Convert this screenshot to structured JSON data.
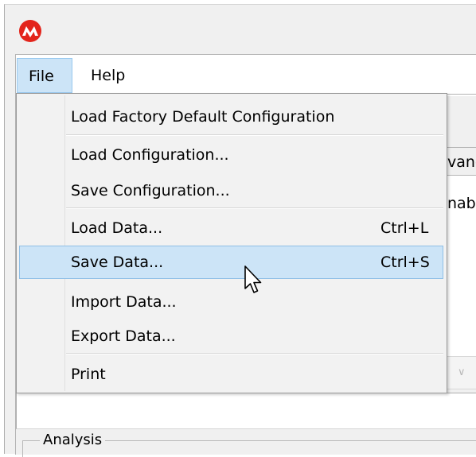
{
  "window": {
    "logo_icon": "microchip-logo-icon",
    "logo_color": "#e3241b"
  },
  "menubar": {
    "file_label": "File",
    "help_label": "Help"
  },
  "file_menu": {
    "items": [
      {
        "label": "Load Factory Default Configuration",
        "shortcut": ""
      },
      {
        "label": "Load Configuration...",
        "shortcut": ""
      },
      {
        "label": "Save Configuration...",
        "shortcut": ""
      },
      {
        "label": "Load Data...",
        "shortcut": "Ctrl+L"
      },
      {
        "label": "Save Data...",
        "shortcut": "Ctrl+S"
      },
      {
        "label": "Import Data...",
        "shortcut": ""
      },
      {
        "label": "Export Data...",
        "shortcut": ""
      },
      {
        "label": "Print",
        "shortcut": ""
      }
    ],
    "highlighted_item": "Save Data..."
  },
  "background": {
    "tab_partial": "vanc",
    "enable_partial": "nab",
    "analysis_group_label": "Analysis"
  },
  "colors": {
    "highlight": "#cce4f7",
    "highlight_border": "#8fbfe6"
  }
}
